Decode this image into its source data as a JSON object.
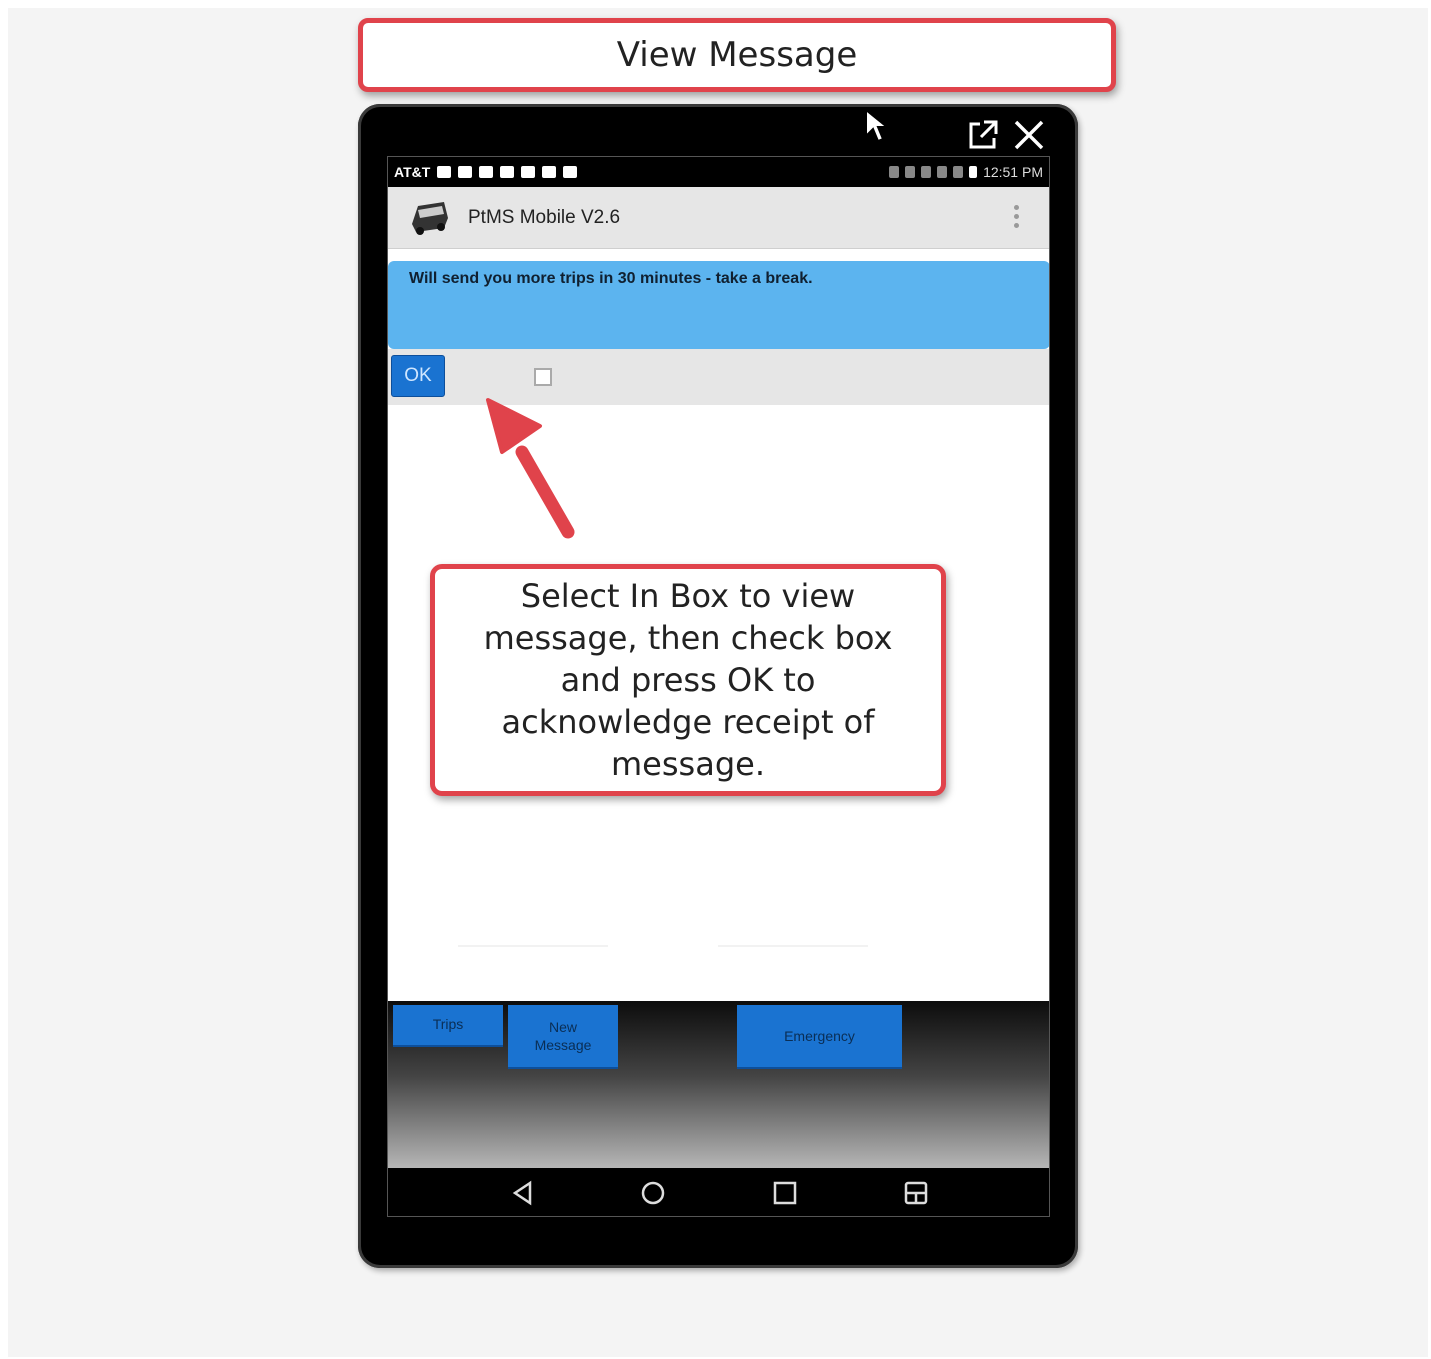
{
  "page_title": "View Message",
  "status_bar": {
    "carrier": "AT&T",
    "time": "12:51 PM"
  },
  "app": {
    "title": "PtMS Mobile V2.6"
  },
  "message": {
    "text": "Will send you more trips in 30 minutes - take a break."
  },
  "actions": {
    "ok_label": "OK"
  },
  "bottom_buttons": {
    "trips": "Trips",
    "new_message": "New Message",
    "emergency": "Emergency"
  },
  "callout": {
    "text": "Select In Box to view message, then check box and press OK to acknowledge receipt of message."
  },
  "colors": {
    "callout_border": "#e0434b",
    "message_bg": "#5cb4ef",
    "button_blue": "#1a73d1"
  },
  "icons": [
    "external-link-icon",
    "close-icon",
    "mouse-pointer-icon",
    "back-icon",
    "home-icon",
    "recents-icon",
    "multiwindow-icon",
    "overflow-menu-icon"
  ]
}
